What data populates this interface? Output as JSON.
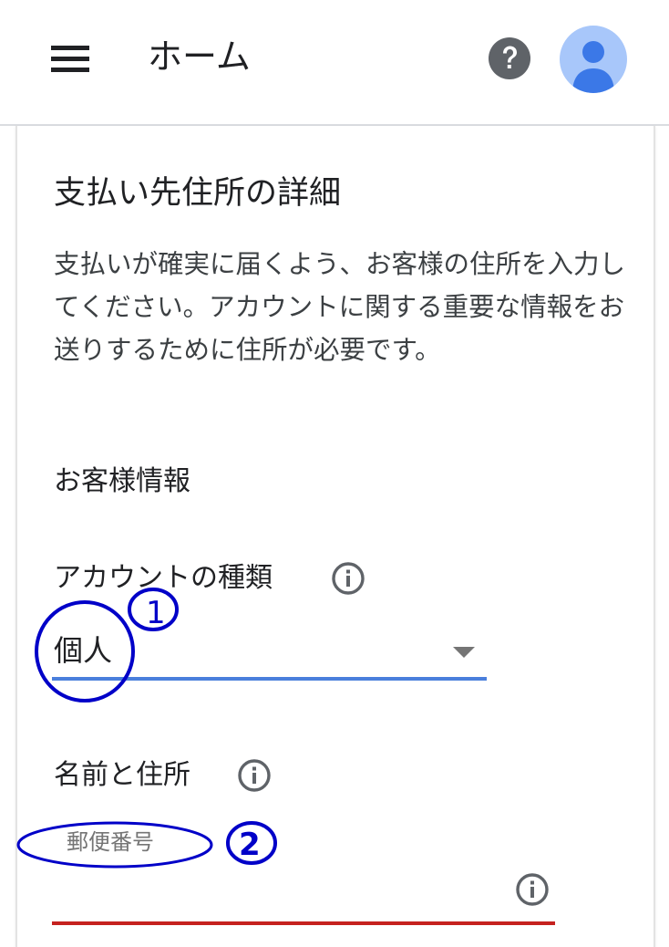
{
  "appbar": {
    "title": "ホーム",
    "menu_icon": "menu-icon",
    "help_icon": "help-icon",
    "avatar_icon": "account-avatar-icon"
  },
  "card": {
    "title": "支払い先住所の詳細",
    "description": "支払いが確実に届くよう、お客様の住所を入力してください。アカウントに関する重要な情報をお送りするために住所が必要です。",
    "customer_info_label": "お客様情報",
    "account_type": {
      "label": "アカウントの種類",
      "value": "個人",
      "info_icon": "info-icon"
    },
    "name_address": {
      "label": "名前と住所",
      "info_icon": "info-icon",
      "postal_code_placeholder": "郵便番号",
      "field_info_icon": "info-icon"
    }
  },
  "annotations": {
    "marker_1": "1",
    "marker_2": "2",
    "color": "#0000c8"
  },
  "colors": {
    "select_underline": "#4a7fdc",
    "error_underline": "#c5221f",
    "avatar_bg": "#a8c7fa",
    "avatar_fg": "#3b78e7",
    "help_icon_bg": "#5f6368"
  }
}
